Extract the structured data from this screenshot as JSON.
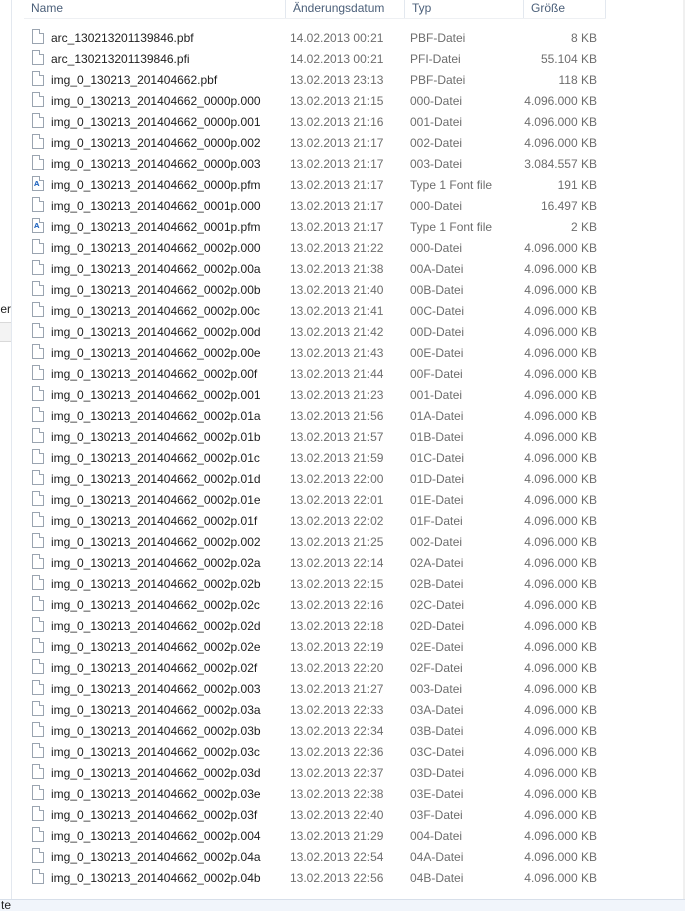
{
  "sidebar": {
    "partial_label": "er"
  },
  "status_bar": {
    "partial_text": "te"
  },
  "columns": {
    "name": "Name",
    "modified": "Änderungsdatum",
    "type": "Typ",
    "size": "Größe"
  },
  "files": [
    {
      "name": "arc_130213201139846.pbf",
      "modified": "14.02.2013 00:21",
      "type": "PBF-Datei",
      "size": "8 KB",
      "icon": "document-icon"
    },
    {
      "name": "arc_130213201139846.pfi",
      "modified": "14.02.2013 00:21",
      "type": "PFI-Datei",
      "size": "55.104 KB",
      "icon": "document-icon"
    },
    {
      "name": "img_0_130213_201404662.pbf",
      "modified": "13.02.2013 23:13",
      "type": "PBF-Datei",
      "size": "118 KB",
      "icon": "document-icon"
    },
    {
      "name": "img_0_130213_201404662_0000p.000",
      "modified": "13.02.2013 21:15",
      "type": "000-Datei",
      "size": "4.096.000 KB",
      "icon": "document-icon"
    },
    {
      "name": "img_0_130213_201404662_0000p.001",
      "modified": "13.02.2013 21:16",
      "type": "001-Datei",
      "size": "4.096.000 KB",
      "icon": "document-icon"
    },
    {
      "name": "img_0_130213_201404662_0000p.002",
      "modified": "13.02.2013 21:17",
      "type": "002-Datei",
      "size": "4.096.000 KB",
      "icon": "document-icon"
    },
    {
      "name": "img_0_130213_201404662_0000p.003",
      "modified": "13.02.2013 21:17",
      "type": "003-Datei",
      "size": "3.084.557 KB",
      "icon": "document-icon"
    },
    {
      "name": "img_0_130213_201404662_0000p.pfm",
      "modified": "13.02.2013 21:17",
      "type": "Type 1 Font file",
      "size": "191 KB",
      "icon": "font-file-icon"
    },
    {
      "name": "img_0_130213_201404662_0001p.000",
      "modified": "13.02.2013 21:17",
      "type": "000-Datei",
      "size": "16.497 KB",
      "icon": "document-icon"
    },
    {
      "name": "img_0_130213_201404662_0001p.pfm",
      "modified": "13.02.2013 21:17",
      "type": "Type 1 Font file",
      "size": "2 KB",
      "icon": "font-file-icon"
    },
    {
      "name": "img_0_130213_201404662_0002p.000",
      "modified": "13.02.2013 21:22",
      "type": "000-Datei",
      "size": "4.096.000 KB",
      "icon": "document-icon"
    },
    {
      "name": "img_0_130213_201404662_0002p.00a",
      "modified": "13.02.2013 21:38",
      "type": "00A-Datei",
      "size": "4.096.000 KB",
      "icon": "document-icon"
    },
    {
      "name": "img_0_130213_201404662_0002p.00b",
      "modified": "13.02.2013 21:40",
      "type": "00B-Datei",
      "size": "4.096.000 KB",
      "icon": "document-icon"
    },
    {
      "name": "img_0_130213_201404662_0002p.00c",
      "modified": "13.02.2013 21:41",
      "type": "00C-Datei",
      "size": "4.096.000 KB",
      "icon": "document-icon"
    },
    {
      "name": "img_0_130213_201404662_0002p.00d",
      "modified": "13.02.2013 21:42",
      "type": "00D-Datei",
      "size": "4.096.000 KB",
      "icon": "document-icon"
    },
    {
      "name": "img_0_130213_201404662_0002p.00e",
      "modified": "13.02.2013 21:43",
      "type": "00E-Datei",
      "size": "4.096.000 KB",
      "icon": "document-icon"
    },
    {
      "name": "img_0_130213_201404662_0002p.00f",
      "modified": "13.02.2013 21:44",
      "type": "00F-Datei",
      "size": "4.096.000 KB",
      "icon": "document-icon"
    },
    {
      "name": "img_0_130213_201404662_0002p.001",
      "modified": "13.02.2013 21:23",
      "type": "001-Datei",
      "size": "4.096.000 KB",
      "icon": "document-icon"
    },
    {
      "name": "img_0_130213_201404662_0002p.01a",
      "modified": "13.02.2013 21:56",
      "type": "01A-Datei",
      "size": "4.096.000 KB",
      "icon": "document-icon"
    },
    {
      "name": "img_0_130213_201404662_0002p.01b",
      "modified": "13.02.2013 21:57",
      "type": "01B-Datei",
      "size": "4.096.000 KB",
      "icon": "document-icon"
    },
    {
      "name": "img_0_130213_201404662_0002p.01c",
      "modified": "13.02.2013 21:59",
      "type": "01C-Datei",
      "size": "4.096.000 KB",
      "icon": "document-icon"
    },
    {
      "name": "img_0_130213_201404662_0002p.01d",
      "modified": "13.02.2013 22:00",
      "type": "01D-Datei",
      "size": "4.096.000 KB",
      "icon": "document-icon"
    },
    {
      "name": "img_0_130213_201404662_0002p.01e",
      "modified": "13.02.2013 22:01",
      "type": "01E-Datei",
      "size": "4.096.000 KB",
      "icon": "document-icon"
    },
    {
      "name": "img_0_130213_201404662_0002p.01f",
      "modified": "13.02.2013 22:02",
      "type": "01F-Datei",
      "size": "4.096.000 KB",
      "icon": "document-icon"
    },
    {
      "name": "img_0_130213_201404662_0002p.002",
      "modified": "13.02.2013 21:25",
      "type": "002-Datei",
      "size": "4.096.000 KB",
      "icon": "document-icon"
    },
    {
      "name": "img_0_130213_201404662_0002p.02a",
      "modified": "13.02.2013 22:14",
      "type": "02A-Datei",
      "size": "4.096.000 KB",
      "icon": "document-icon"
    },
    {
      "name": "img_0_130213_201404662_0002p.02b",
      "modified": "13.02.2013 22:15",
      "type": "02B-Datei",
      "size": "4.096.000 KB",
      "icon": "document-icon"
    },
    {
      "name": "img_0_130213_201404662_0002p.02c",
      "modified": "13.02.2013 22:16",
      "type": "02C-Datei",
      "size": "4.096.000 KB",
      "icon": "document-icon"
    },
    {
      "name": "img_0_130213_201404662_0002p.02d",
      "modified": "13.02.2013 22:18",
      "type": "02D-Datei",
      "size": "4.096.000 KB",
      "icon": "document-icon"
    },
    {
      "name": "img_0_130213_201404662_0002p.02e",
      "modified": "13.02.2013 22:19",
      "type": "02E-Datei",
      "size": "4.096.000 KB",
      "icon": "document-icon"
    },
    {
      "name": "img_0_130213_201404662_0002p.02f",
      "modified": "13.02.2013 22:20",
      "type": "02F-Datei",
      "size": "4.096.000 KB",
      "icon": "document-icon"
    },
    {
      "name": "img_0_130213_201404662_0002p.003",
      "modified": "13.02.2013 21:27",
      "type": "003-Datei",
      "size": "4.096.000 KB",
      "icon": "document-icon"
    },
    {
      "name": "img_0_130213_201404662_0002p.03a",
      "modified": "13.02.2013 22:33",
      "type": "03A-Datei",
      "size": "4.096.000 KB",
      "icon": "document-icon"
    },
    {
      "name": "img_0_130213_201404662_0002p.03b",
      "modified": "13.02.2013 22:34",
      "type": "03B-Datei",
      "size": "4.096.000 KB",
      "icon": "document-icon"
    },
    {
      "name": "img_0_130213_201404662_0002p.03c",
      "modified": "13.02.2013 22:36",
      "type": "03C-Datei",
      "size": "4.096.000 KB",
      "icon": "document-icon"
    },
    {
      "name": "img_0_130213_201404662_0002p.03d",
      "modified": "13.02.2013 22:37",
      "type": "03D-Datei",
      "size": "4.096.000 KB",
      "icon": "document-icon"
    },
    {
      "name": "img_0_130213_201404662_0002p.03e",
      "modified": "13.02.2013 22:38",
      "type": "03E-Datei",
      "size": "4.096.000 KB",
      "icon": "document-icon"
    },
    {
      "name": "img_0_130213_201404662_0002p.03f",
      "modified": "13.02.2013 22:40",
      "type": "03F-Datei",
      "size": "4.096.000 KB",
      "icon": "document-icon"
    },
    {
      "name": "img_0_130213_201404662_0002p.004",
      "modified": "13.02.2013 21:29",
      "type": "004-Datei",
      "size": "4.096.000 KB",
      "icon": "document-icon"
    },
    {
      "name": "img_0_130213_201404662_0002p.04a",
      "modified": "13.02.2013 22:54",
      "type": "04A-Datei",
      "size": "4.096.000 KB",
      "icon": "document-icon"
    },
    {
      "name": "img_0_130213_201404662_0002p.04b",
      "modified": "13.02.2013 22:56",
      "type": "04B-Datei",
      "size": "4.096.000 KB",
      "icon": "document-icon"
    }
  ]
}
